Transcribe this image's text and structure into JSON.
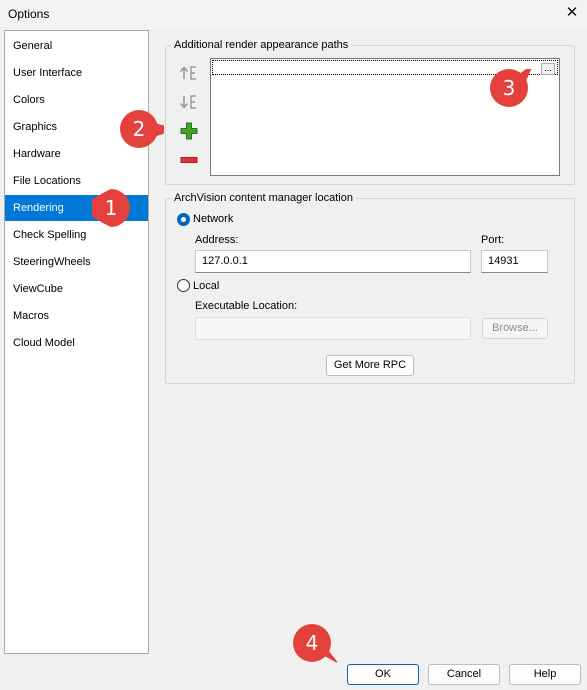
{
  "window": {
    "title": "Options",
    "close_glyph": "✕"
  },
  "sidebar": {
    "items": [
      {
        "label": "General"
      },
      {
        "label": "User Interface"
      },
      {
        "label": "Colors"
      },
      {
        "label": "Graphics"
      },
      {
        "label": "Hardware"
      },
      {
        "label": "File Locations"
      },
      {
        "label": "Rendering",
        "selected": true
      },
      {
        "label": "Check Spelling"
      },
      {
        "label": "SteeringWheels"
      },
      {
        "label": "ViewCube"
      },
      {
        "label": "Macros"
      },
      {
        "label": "Cloud Model"
      }
    ]
  },
  "render_paths": {
    "group_label": "Additional render appearance paths",
    "browse_label": "...",
    "tool_icons": [
      "move-up-icon",
      "move-down-icon",
      "add-icon",
      "remove-icon"
    ]
  },
  "archvision": {
    "group_label": "ArchVision content manager location",
    "network_label": "Network",
    "network_selected": true,
    "address_label": "Address:",
    "address_value": "127.0.0.1",
    "port_label": "Port:",
    "port_value": "14931",
    "local_label": "Local",
    "executable_label": "Executable Location:",
    "executable_value": "",
    "browse_label": "Browse...",
    "get_more_label": "Get More RPC"
  },
  "footer": {
    "ok_label": "OK",
    "cancel_label": "Cancel",
    "help_label": "Help"
  },
  "callouts": [
    "1",
    "2",
    "3",
    "4"
  ],
  "colors": {
    "accent": "#0078d7",
    "callout": "#e5413c",
    "add": "#3d9a22",
    "remove": "#e0303a"
  }
}
